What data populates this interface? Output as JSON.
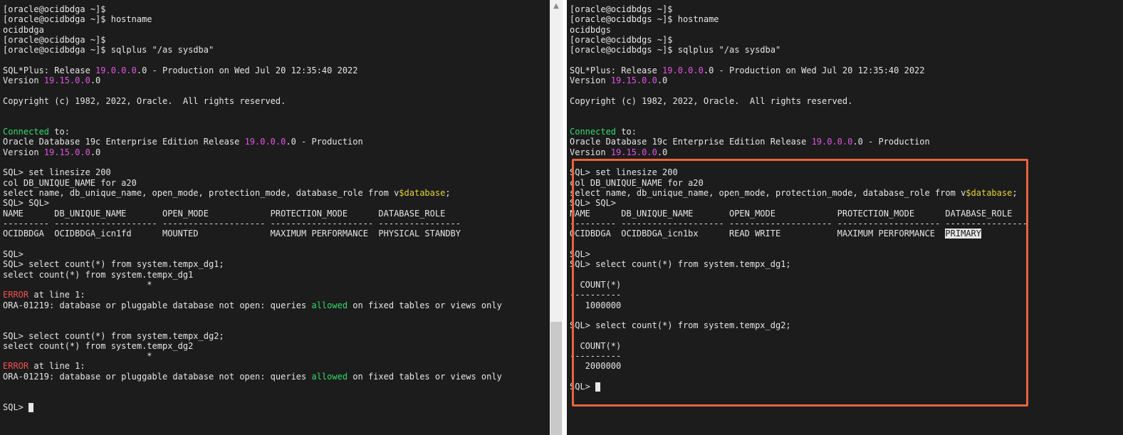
{
  "colors": {
    "terminal_bg": "#1c1c1c",
    "text": "#e6e6e6",
    "magenta": "#e254e2",
    "green": "#34d96c",
    "red": "#f25050",
    "yellow": "#e6d23c",
    "highlight_box": "#e8643c"
  },
  "left": {
    "lines": [
      [
        {
          "t": "[oracle@ocidbdga ~]$"
        }
      ],
      [
        {
          "t": "[oracle@ocidbdga ~]$ hostname"
        }
      ],
      [
        {
          "t": "ocidbdga"
        }
      ],
      [
        {
          "t": "[oracle@ocidbdga ~]$"
        }
      ],
      [
        {
          "t": "[oracle@ocidbdga ~]$ sqlplus \"/as sysdba\""
        }
      ],
      [
        {
          "t": ""
        }
      ],
      [
        {
          "t": "SQL*Plus: Release "
        },
        {
          "t": "19.0.0.0",
          "c": "magenta"
        },
        {
          "t": ".0 - Production on Wed Jul 20 12:35:40 2022"
        }
      ],
      [
        {
          "t": "Version "
        },
        {
          "t": "19.15.0.0",
          "c": "magenta"
        },
        {
          "t": ".0"
        }
      ],
      [
        {
          "t": ""
        }
      ],
      [
        {
          "t": "Copyright (c) 1982, 2022, Oracle.  All rights reserved."
        }
      ],
      [
        {
          "t": ""
        }
      ],
      [
        {
          "t": ""
        }
      ],
      [
        {
          "t": "Connected",
          "c": "green"
        },
        {
          "t": " to:"
        }
      ],
      [
        {
          "t": "Oracle Database 19c Enterprise Edition Release "
        },
        {
          "t": "19.0.0.0",
          "c": "magenta"
        },
        {
          "t": ".0 - Production"
        }
      ],
      [
        {
          "t": "Version "
        },
        {
          "t": "19.15.0.0",
          "c": "magenta"
        },
        {
          "t": ".0"
        }
      ],
      [
        {
          "t": ""
        }
      ],
      [
        {
          "t": "SQL> set linesize 200"
        }
      ],
      [
        {
          "t": "col DB_UNIQUE_NAME for a20"
        }
      ],
      [
        {
          "t": "select name, db_unique_name, open_mode, protection_mode, database_role from v"
        },
        {
          "t": "$database",
          "c": "yellow"
        },
        {
          "t": ";"
        }
      ],
      [
        {
          "t": "SQL> SQL>"
        }
      ],
      [
        {
          "t": "NAME      DB_UNIQUE_NAME       OPEN_MODE            PROTECTION_MODE      DATABASE_ROLE"
        }
      ],
      [
        {
          "t": "--------- -------------------- -------------------- -------------------- ----------------"
        }
      ],
      [
        {
          "t": "OCIDBDGA  OCIDBDGA_icn1fd      MOUNTED              MAXIMUM PERFORMANCE  PHYSICAL STANDBY"
        }
      ],
      [
        {
          "t": ""
        }
      ],
      [
        {
          "t": "SQL>"
        }
      ],
      [
        {
          "t": "SQL> select count(*) from system.tempx_dg1;"
        }
      ],
      [
        {
          "t": "select count(*) from system.tempx_dg1"
        }
      ],
      [
        {
          "t": "                            *"
        }
      ],
      [
        {
          "t": "ERROR",
          "c": "red"
        },
        {
          "t": " at line 1:"
        }
      ],
      [
        {
          "t": "ORA-01219: database or pluggable database not open: queries "
        },
        {
          "t": "allowed",
          "c": "green"
        },
        {
          "t": " on fixed tables or views only"
        }
      ],
      [
        {
          "t": ""
        }
      ],
      [
        {
          "t": ""
        }
      ],
      [
        {
          "t": "SQL> select count(*) from system.tempx_dg2;"
        }
      ],
      [
        {
          "t": "select count(*) from system.tempx_dg2"
        }
      ],
      [
        {
          "t": "                            *"
        }
      ],
      [
        {
          "t": "ERROR",
          "c": "red"
        },
        {
          "t": " at line 1:"
        }
      ],
      [
        {
          "t": "ORA-01219: database or pluggable database not open: queries "
        },
        {
          "t": "allowed",
          "c": "green"
        },
        {
          "t": " on fixed tables or views only"
        }
      ],
      [
        {
          "t": ""
        }
      ],
      [
        {
          "t": ""
        }
      ],
      [
        {
          "t": "SQL> "
        },
        {
          "cursor": true
        }
      ]
    ]
  },
  "right": {
    "lines": [
      [
        {
          "t": "[oracle@ocidbdgs ~]$"
        }
      ],
      [
        {
          "t": "[oracle@ocidbdgs ~]$ hostname"
        }
      ],
      [
        {
          "t": "ocidbdgs"
        }
      ],
      [
        {
          "t": "[oracle@ocidbdgs ~]$"
        }
      ],
      [
        {
          "t": "[oracle@ocidbdgs ~]$ sqlplus \"/as sysdba\""
        }
      ],
      [
        {
          "t": ""
        }
      ],
      [
        {
          "t": "SQL*Plus: Release "
        },
        {
          "t": "19.0.0.0",
          "c": "magenta"
        },
        {
          "t": ".0 - Production on Wed Jul 20 12:35:40 2022"
        }
      ],
      [
        {
          "t": "Version "
        },
        {
          "t": "19.15.0.0",
          "c": "magenta"
        },
        {
          "t": ".0"
        }
      ],
      [
        {
          "t": ""
        }
      ],
      [
        {
          "t": "Copyright (c) 1982, 2022, Oracle.  All rights reserved."
        }
      ],
      [
        {
          "t": ""
        }
      ],
      [
        {
          "t": ""
        }
      ],
      [
        {
          "t": "Connected",
          "c": "green"
        },
        {
          "t": " to:"
        }
      ],
      [
        {
          "t": "Oracle Database 19c Enterprise Edition Release "
        },
        {
          "t": "19.0.0.0",
          "c": "magenta"
        },
        {
          "t": ".0 - Production"
        }
      ],
      [
        {
          "t": "Version "
        },
        {
          "t": "19.15.0.0",
          "c": "magenta"
        },
        {
          "t": ".0"
        }
      ],
      [
        {
          "t": ""
        }
      ],
      [
        {
          "t": "SQL> set linesize 200"
        }
      ],
      [
        {
          "t": "col DB_UNIQUE_NAME for a20"
        }
      ],
      [
        {
          "t": "select name, db_unique_name, open_mode, protection_mode, database_role from v"
        },
        {
          "t": "$database",
          "c": "yellow"
        },
        {
          "t": ";"
        }
      ],
      [
        {
          "t": "SQL> SQL>"
        }
      ],
      [
        {
          "t": "NAME      DB_UNIQUE_NAME       OPEN_MODE            PROTECTION_MODE      DATABASE_ROLE"
        }
      ],
      [
        {
          "t": "--------- -------------------- -------------------- -------------------- ----------------"
        }
      ],
      [
        {
          "t": "OCIDBDGA  OCIDBDGA_icn1bx      READ WRITE           MAXIMUM PERFORMANCE  "
        },
        {
          "t": "PRIMARY",
          "c": "selected"
        }
      ],
      [
        {
          "t": ""
        }
      ],
      [
        {
          "t": "SQL>"
        }
      ],
      [
        {
          "t": "SQL> select count(*) from system.tempx_dg1;"
        }
      ],
      [
        {
          "t": ""
        }
      ],
      [
        {
          "t": "  COUNT(*)"
        }
      ],
      [
        {
          "t": "----------"
        }
      ],
      [
        {
          "t": "   1000000"
        }
      ],
      [
        {
          "t": ""
        }
      ],
      [
        {
          "t": "SQL> select count(*) from system.tempx_dg2;"
        }
      ],
      [
        {
          "t": ""
        }
      ],
      [
        {
          "t": "  COUNT(*)"
        }
      ],
      [
        {
          "t": "----------"
        }
      ],
      [
        {
          "t": "   2000000"
        }
      ],
      [
        {
          "t": ""
        }
      ],
      [
        {
          "t": "SQL> "
        },
        {
          "cursor": true
        }
      ]
    ]
  }
}
